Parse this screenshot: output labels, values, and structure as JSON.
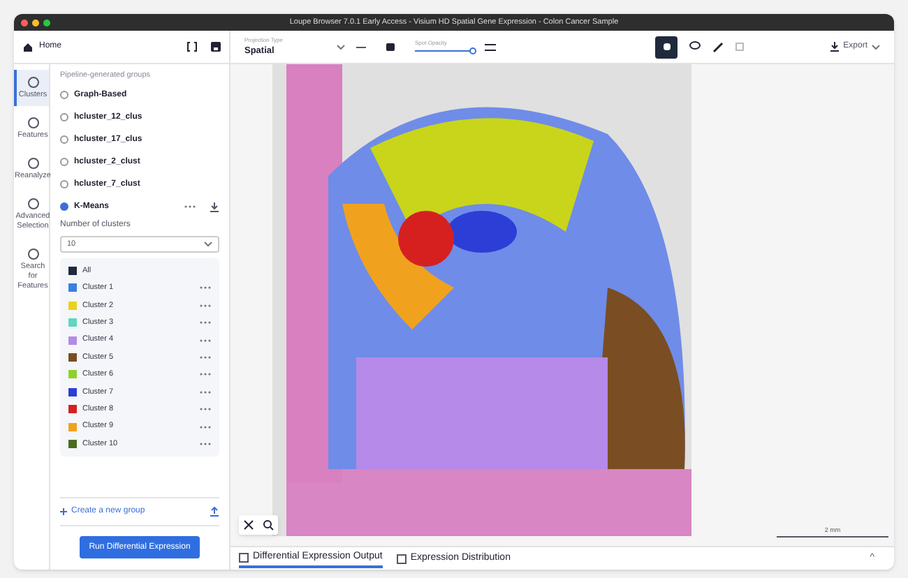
{
  "window": {
    "title": "Loupe Browser 7.0.1 Early Access - Visium HD Spatial Gene Expression - Colon Cancer Sample"
  },
  "toolbar": {
    "home": "Home",
    "projection_label": "Projection Type",
    "projection_value": "Spatial",
    "opacity_label": "Spot Opacity",
    "opacity": {
      "level": 0.95
    },
    "export": "Export"
  },
  "nav": [
    {
      "label": "Clusters",
      "selected": true
    },
    {
      "label": "Features",
      "selected": false
    },
    {
      "label": "Reanalyze",
      "selected": false
    },
    {
      "label": "Advanced Selection",
      "selected": false
    },
    {
      "label": "Search for Features",
      "selected": false
    }
  ],
  "groups": {
    "heading": "Pipeline-generated groups",
    "options": [
      {
        "label": "Graph-Based",
        "selected": false
      },
      {
        "label": "hcluster_12_clus",
        "selected": false
      },
      {
        "label": "hcluster_17_clus",
        "selected": false
      },
      {
        "label": "hcluster_2_clust",
        "selected": false
      },
      {
        "label": "hcluster_7_clust",
        "selected": false
      },
      {
        "label": "K-Means",
        "selected": true
      }
    ],
    "number_label": "Number of clusters",
    "number_value": "10",
    "all": {
      "label": "All",
      "checked": true
    },
    "clusters": [
      {
        "label": "Cluster 1",
        "color": "#3b7fe0",
        "checked": true
      },
      {
        "label": "Cluster 2",
        "color": "#e8d21c",
        "checked": true
      },
      {
        "label": "Cluster 3",
        "color": "#5fd6c0",
        "checked": true
      },
      {
        "label": "Cluster 4",
        "color": "#b58ae8",
        "checked": true
      },
      {
        "label": "Cluster 5",
        "color": "#7a4e22",
        "checked": true
      },
      {
        "label": "Cluster 6",
        "color": "#8fd12a",
        "checked": true
      },
      {
        "label": "Cluster 7",
        "color": "#2c3ed6",
        "checked": true
      },
      {
        "label": "Cluster 8",
        "color": "#d62020",
        "checked": true
      },
      {
        "label": "Cluster 9",
        "color": "#f0a21e",
        "checked": true
      },
      {
        "label": "Cluster 10",
        "color": "#4b6b1c",
        "checked": true
      }
    ],
    "create": "Create a new group",
    "run": "Run Differential Expression"
  },
  "scale": "2 mm",
  "bottom_tabs": [
    {
      "label": "Differential Expression Output",
      "selected": true
    },
    {
      "label": "Expression Distribution",
      "selected": false
    }
  ],
  "collapse": "^"
}
